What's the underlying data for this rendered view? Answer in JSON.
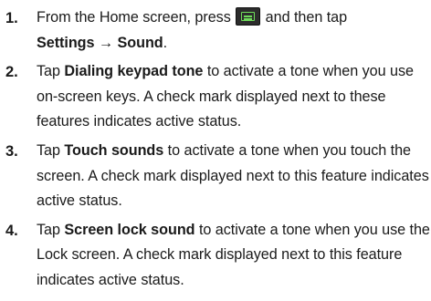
{
  "steps": [
    {
      "number": "1.",
      "t1": "From the Home screen, press",
      "t2": "and then tap",
      "b1": "Settings",
      "arrow": "→",
      "b2": "Sound",
      "t3": "."
    },
    {
      "number": "2.",
      "t1": "Tap",
      "b1": "Dialing keypad tone",
      "t2": "to activate a tone when you use on-screen keys. A check mark displayed next to these features indicates active status."
    },
    {
      "number": "3.",
      "t1": "Tap",
      "b1": "Touch sounds",
      "t2": "to activate a tone when you touch the screen. A check mark displayed next to this feature indicates active status."
    },
    {
      "number": "4.",
      "t1": "Tap",
      "b1": "Screen lock sound",
      "t2": "to activate a tone when you use the Lock screen. A check mark displayed next to this feature indicates active status."
    }
  ],
  "icons": {
    "menu_key": "menu-key-icon",
    "menu_key_color": "#2c2c2c",
    "menu_key_accent": "#6fdc5a"
  }
}
